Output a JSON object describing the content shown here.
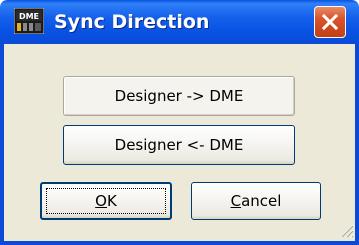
{
  "window": {
    "title": "Sync Direction",
    "app_icon": "dme-icon",
    "app_icon_text": "DME"
  },
  "buttons": {
    "designer_to_dme": "Designer -> DME",
    "dme_to_designer": "Designer <- DME",
    "ok_mnemonic": "O",
    "ok_rest": "K",
    "cancel_mnemonic": "C",
    "cancel_rest": "ancel"
  },
  "colors": {
    "titlebar": "#0a53e2",
    "close_button": "#d9532b",
    "dialog_bg": "#ece9d8"
  }
}
